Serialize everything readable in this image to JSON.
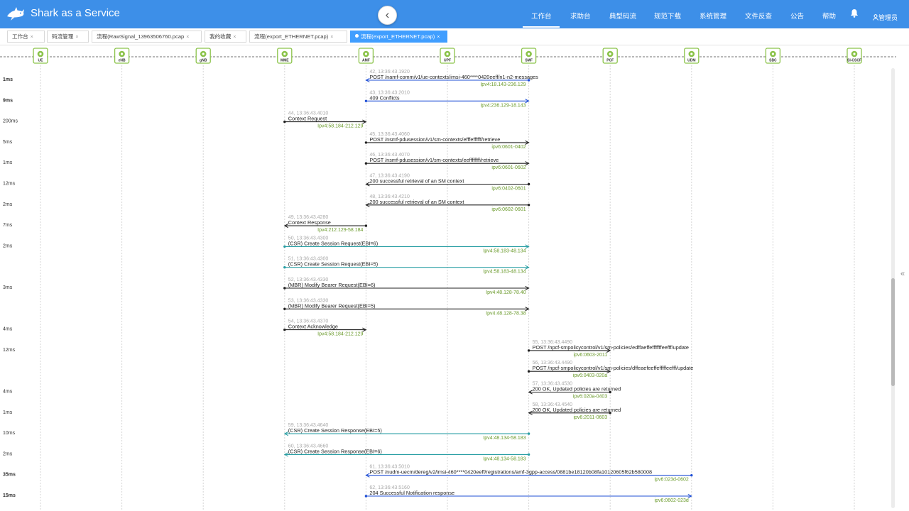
{
  "app": {
    "title": "Shark as a Service",
    "logo_icon": "shark-icon"
  },
  "nav": {
    "items": [
      {
        "label": "工作台",
        "active": true
      },
      {
        "label": "求助台",
        "active": false
      },
      {
        "label": "典型码流",
        "active": false
      },
      {
        "label": "规范下载",
        "active": false
      },
      {
        "label": "系统管理",
        "active": false
      },
      {
        "label": "文件反查",
        "active": false
      },
      {
        "label": "公告",
        "active": false
      },
      {
        "label": "帮助",
        "active": false
      }
    ],
    "bell_icon": "bell-icon",
    "user_label": "管理员",
    "user_icon": "user-icon",
    "collapse_icon": "chevron-left-icon"
  },
  "tabs": [
    {
      "label": "工作台",
      "close": "×",
      "active": false
    },
    {
      "label": "码流管理",
      "close": "×",
      "active": false
    },
    {
      "label": "流程(RawSignal_13963506760.pcap",
      "close": "×",
      "active": false
    },
    {
      "label": "我的收藏",
      "close": "×",
      "active": false
    },
    {
      "label": "流程(export_ETHERNET.pcap)",
      "close": "×",
      "active": false
    },
    {
      "label": "流程(export_ETHERNET.pcap)",
      "close": "×",
      "active": true
    }
  ],
  "side_toggle_icon": "double-chevron-left-icon",
  "colors": {
    "header_bg": "#3d8fe8",
    "active_tab": "#409eff",
    "entity_green": "#8bc34a",
    "addr_green": "#6a9a2b",
    "msg_blue": "#1f4fd6",
    "msg_black": "#222222",
    "msg_teal": "#2a9fa4"
  },
  "entities": [
    "UE",
    "eNB",
    "gNB",
    "MME",
    "AMF",
    "UPF",
    "SMF",
    "PCF",
    "UDM",
    "SBC",
    "SI-CSCF"
  ],
  "rows": [
    {
      "delta": "1ms",
      "bold": true,
      "from": "AMF",
      "to": "SMF",
      "dir": "left",
      "color": "blue",
      "header": "42, 13:36:43.1920",
      "text": "POST /namf-comm/v1/ue-contexts/imsi-460****0420eeff/n1-n2-messages",
      "addr": "Ipv4:18.143-236.129"
    },
    {
      "delta": "9ms",
      "bold": true,
      "from": "AMF",
      "to": "SMF",
      "dir": "right",
      "color": "blue",
      "header": "43, 13:36:43.2010",
      "text": "409 Conflicts",
      "addr": "Ipv4:236.129-18.143"
    },
    {
      "delta": "200ms",
      "bold": false,
      "from": "MME",
      "to": "AMF",
      "dir": "right",
      "color": "black",
      "header": "44, 13:36:43.4010",
      "text": "Context Request",
      "addr": "Ipv4:58.184-212.129"
    },
    {
      "delta": "5ms",
      "bold": false,
      "from": "AMF",
      "to": "SMF",
      "dir": "right",
      "color": "black",
      "header": "45, 13:36:43.4060",
      "text": "POST /nsmf-pdusession/v1/sm-contexts/efffeffffff/retrieve",
      "addr": "ipv6:0601-0402"
    },
    {
      "delta": "1ms",
      "bold": false,
      "from": "AMF",
      "to": "SMF",
      "dir": "right",
      "color": "black",
      "header": "46, 13:36:43.4070",
      "text": "POST /nsmf-pdusession/v1/sm-contexts/eeffffffff/retrieve",
      "addr": "ipv6:0601-0602"
    },
    {
      "delta": "12ms",
      "bold": false,
      "from": "AMF",
      "to": "SMF",
      "dir": "left",
      "color": "black",
      "header": "47, 13:36:43.4190",
      "text": "200 successful retrieval of an SM context",
      "addr": "ipv6:0402-0601"
    },
    {
      "delta": "2ms",
      "bold": false,
      "from": "AMF",
      "to": "SMF",
      "dir": "left",
      "color": "black",
      "header": "48, 13:36:43.4210",
      "text": "200 successful retrieval of an SM context",
      "addr": "ipv6:0602-0601"
    },
    {
      "delta": "7ms",
      "bold": false,
      "from": "MME",
      "to": "AMF",
      "dir": "left",
      "color": "black",
      "header": "49, 13:36:43.4280",
      "text": "Context Response",
      "addr": "Ipv4:212.129-58.184"
    },
    {
      "delta": "2ms",
      "bold": false,
      "from": "MME",
      "to": "SMF",
      "dir": "right",
      "color": "teal",
      "header": "50, 13:36:43.4300",
      "text": "(CSR) Create Session Request(EBI=6)",
      "addr": "Ipv4:58.183-48.134"
    },
    {
      "delta": "",
      "bold": false,
      "from": "MME",
      "to": "SMF",
      "dir": "right",
      "color": "teal",
      "header": "51, 13:36:43.4300",
      "text": "(CSR) Create Session Request(EBI=5)",
      "addr": "Ipv4:58.183-48.134"
    },
    {
      "delta": "3ms",
      "bold": false,
      "from": "MME",
      "to": "SMF",
      "dir": "right",
      "color": "black",
      "header": "52, 13:36:43.4330",
      "text": "(MBR) Modify Bearer Request(EBI=6)",
      "addr": "Ipv4:48.128-78.40"
    },
    {
      "delta": "",
      "bold": false,
      "from": "MME",
      "to": "SMF",
      "dir": "right",
      "color": "black",
      "header": "53, 13:36:43.4330",
      "text": "(MBR) Modify Bearer Request(EBI=5)",
      "addr": "Ipv4:48.128-78.38"
    },
    {
      "delta": "4ms",
      "bold": false,
      "from": "MME",
      "to": "AMF",
      "dir": "right",
      "color": "black",
      "header": "54, 13:36:43.4370",
      "text": "Context Acknowledge",
      "addr": "Ipv4:58.184-212.129"
    },
    {
      "delta": "12ms",
      "bold": false,
      "from": "SMF",
      "to": "PCF",
      "dir": "right",
      "color": "black",
      "header": "55, 13:36:43.4490",
      "text": "POST /npcf-smpolicycontrol/v1/sm-policies/edffaeffefffffffeefff/update",
      "addr": "ipv6:0603-2011"
    },
    {
      "delta": "",
      "bold": false,
      "from": "SMF",
      "to": "PCF",
      "dir": "right",
      "color": "black",
      "header": "56, 13:36:43.4490",
      "text": "POST /npcf-smpolicycontrol/v1/sm-policies/dffeaefeeffefffffeefff/update",
      "addr": "ipv6:0403-020a"
    },
    {
      "delta": "4ms",
      "bold": false,
      "from": "SMF",
      "to": "PCF",
      "dir": "left",
      "color": "black",
      "header": "57, 13:36:43.4530",
      "text": "200 OK, Updated policies are returned",
      "addr": "ipv6:020a-0403"
    },
    {
      "delta": "1ms",
      "bold": false,
      "from": "SMF",
      "to": "PCF",
      "dir": "left",
      "color": "black",
      "header": "58, 13:36:43.4540",
      "text": "200 OK, Updated policies are returned",
      "addr": "ipv6:2011-0603"
    },
    {
      "delta": "10ms",
      "bold": false,
      "from": "MME",
      "to": "SMF",
      "dir": "left",
      "color": "teal",
      "header": "59, 13:36:43.4640",
      "text": "(CSR) Create Session Response(EBI=5)",
      "addr": "Ipv4:48.134-58.183"
    },
    {
      "delta": "2ms",
      "bold": false,
      "from": "MME",
      "to": "SMF",
      "dir": "left",
      "color": "teal",
      "header": "60, 13:36:43.4660",
      "text": "(CSR) Create Session Response(EBI=6)",
      "addr": "Ipv4:48.134-58.183"
    },
    {
      "delta": "35ms",
      "bold": true,
      "from": "AMF",
      "to": "UDM",
      "dir": "left",
      "color": "blue",
      "header": "61, 13:36:43.5010",
      "text": "POST /nudm-uecm/dereg/v2/imsi-460****0420eeff/registrations/amf-3gpp-access/0881be18120b08fa10120605f62b580008",
      "addr": "ipv6:023d-0602"
    },
    {
      "delta": "15ms",
      "bold": true,
      "from": "AMF",
      "to": "UDM",
      "dir": "right",
      "color": "blue",
      "header": "62, 13:36:43.5160",
      "text": "204 Successful Notification response",
      "addr": "ipv6:0602-023d"
    }
  ]
}
